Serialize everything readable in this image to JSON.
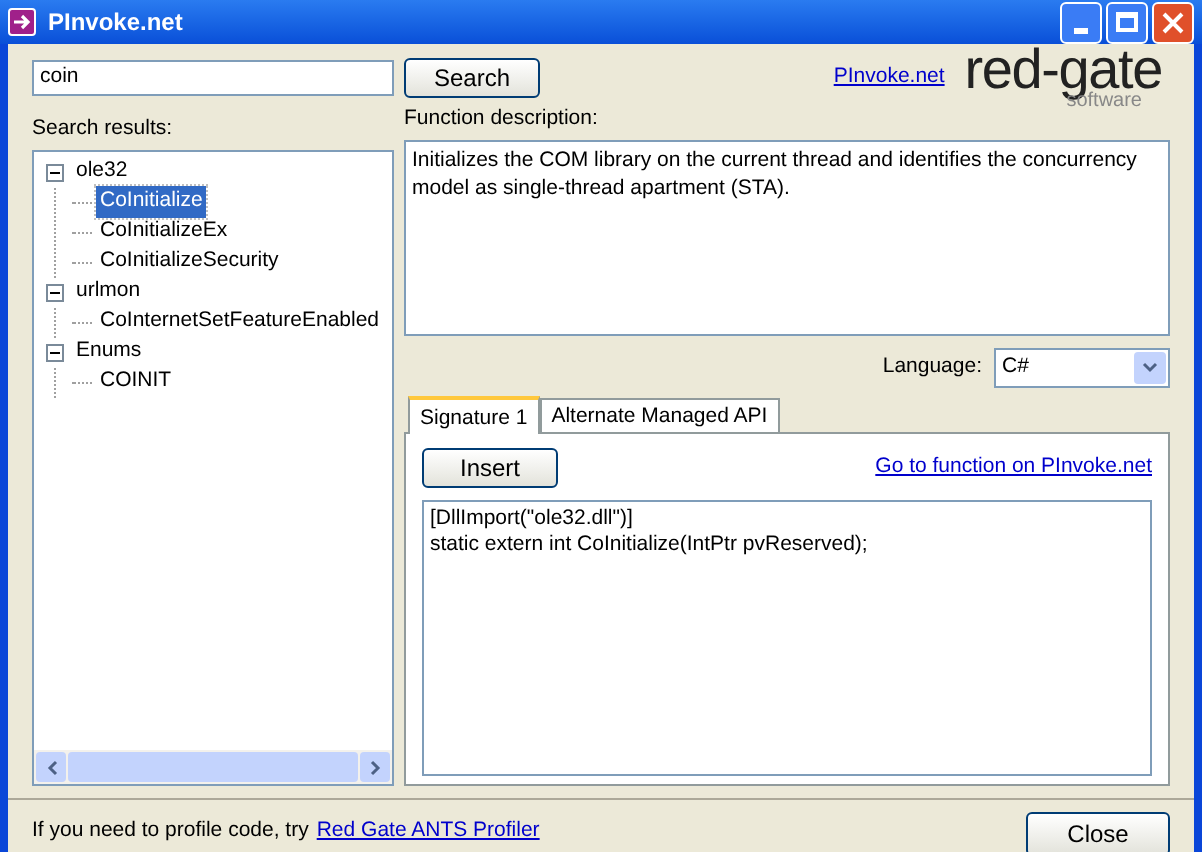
{
  "window": {
    "title": "PInvoke.net"
  },
  "search": {
    "value": "coin",
    "button": "Search"
  },
  "header_link": "PInvoke.net",
  "logo": {
    "name": "red-gate",
    "tagline": "software"
  },
  "results": {
    "label": "Search results:",
    "tree": [
      {
        "label": "ole32",
        "expanded": true,
        "selected": false,
        "children": [
          {
            "label": "CoInitialize",
            "selected": true
          },
          {
            "label": "CoInitializeEx",
            "selected": false
          },
          {
            "label": "CoInitializeSecurity",
            "selected": false
          }
        ]
      },
      {
        "label": "urlmon",
        "expanded": true,
        "selected": false,
        "children": [
          {
            "label": "CoInternetSetFeatureEnabled",
            "selected": false
          }
        ]
      },
      {
        "label": "Enums",
        "expanded": true,
        "selected": false,
        "children": [
          {
            "label": "COINIT",
            "selected": false
          }
        ]
      }
    ]
  },
  "description": {
    "label": "Function description:",
    "text": "Initializes the COM library on the current thread and identifies the concurrency model as single-thread apartment (STA)."
  },
  "language": {
    "label": "Language:",
    "value": "C#"
  },
  "tabs": [
    {
      "label": "Signature 1",
      "selected": true
    },
    {
      "label": "Alternate Managed API",
      "selected": false
    }
  ],
  "signature": {
    "button": "Insert",
    "link": "Go to function on PInvoke.net",
    "code": "[DllImport(\"ole32.dll\")]\nstatic extern int CoInitialize(IntPtr pvReserved);"
  },
  "footer": {
    "text": "If you need to profile code, try",
    "link": "Red Gate ANTS Profiler",
    "button": "Close"
  }
}
